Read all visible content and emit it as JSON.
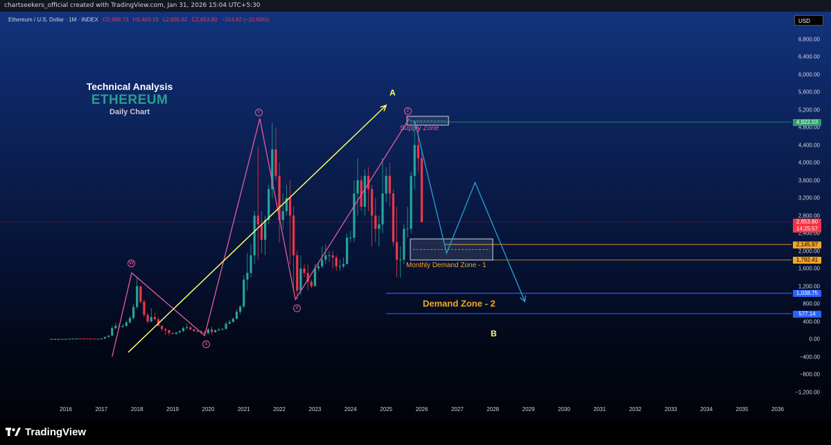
{
  "header": {
    "creator_line": "chartseekers_official created with TradingView.com, Jan 31, 2026 15:04 UTC+5:30"
  },
  "legend": {
    "symbol": "Ethereum / U.S. Dollar · 1M · INDEX",
    "open": "O2,968.73",
    "high": "H3,403.19",
    "low": "L2,605.62",
    "close": "C2,653.80",
    "change": "−314.82 (−10.60%)"
  },
  "currency_button": "USD",
  "titles": {
    "line1": "Technical Analysis",
    "line2": "ETHEREUM",
    "line3": "Daily Chart"
  },
  "annotations": {
    "wave_w": "W",
    "wave_x1": "X",
    "wave_y": "Y",
    "wave_x2": "X",
    "wave_z": "Z",
    "point_a": "A",
    "point_b": "B",
    "supply_zone": "Supply Zone",
    "monthly_demand": "Monthly Demand Zone - 1",
    "demand_zone_2": "Demand Zone - 2"
  },
  "price_tags": {
    "resistance": "4,922.03",
    "current_price": "2,653.80",
    "countdown": "14:25:57",
    "demand_top": "2,145.97",
    "demand_bottom": "1,792.41",
    "demand2_top": "1,038.75",
    "demand2_bottom": "577.14"
  },
  "footer": {
    "brand": "TradingView"
  },
  "colors": {
    "up_candle": "#26a69a",
    "down_candle": "#f23645",
    "wave_pink": "#e85b9e",
    "trend_yellow": "#ffff66",
    "projection_cyan": "#26a4d8",
    "demand_orange": "#f5a623",
    "zone2_blue": "#2962ff"
  },
  "chart_data": {
    "type": "candlestick",
    "title": "",
    "xlabel": "",
    "ylabel": "",
    "x_ticks": [
      "2016",
      "2017",
      "2018",
      "2019",
      "2020",
      "2021",
      "2022",
      "2023",
      "2024",
      "2025",
      "2026",
      "2027",
      "2028",
      "2029",
      "2030",
      "2031",
      "2032",
      "2033",
      "2034",
      "2035",
      "2036"
    ],
    "y_ticks": [
      "6,800.00",
      "6,400.00",
      "6,000.00",
      "5,600.00",
      "5,200.00",
      "4,800.00",
      "4,400.00",
      "4,000.00",
      "3,600.00",
      "3,200.00",
      "2,800.00",
      "2,400.00",
      "2,000.00",
      "1,600.00",
      "1,200.00",
      "800.00",
      "400.00",
      "0.00",
      "−400.00",
      "−800.00",
      "−1,200.00"
    ],
    "ylim": [
      -1200,
      6800
    ],
    "series": [
      {
        "name": "Ethereum / U.S. Dollar",
        "time": [
          2015.6,
          2015.7,
          2015.8,
          2015.9,
          2016.0,
          2016.1,
          2016.2,
          2016.3,
          2016.4,
          2016.5,
          2016.6,
          2016.7,
          2016.8,
          2016.9,
          2017.0,
          2017.1,
          2017.2,
          2017.3,
          2017.4,
          2017.5,
          2017.6,
          2017.7,
          2017.8,
          2017.9,
          2018.0,
          2018.1,
          2018.2,
          2018.3,
          2018.4,
          2018.5,
          2018.6,
          2018.7,
          2018.8,
          2018.9,
          2019.0,
          2019.1,
          2019.2,
          2019.3,
          2019.4,
          2019.5,
          2019.6,
          2019.7,
          2019.8,
          2019.9,
          2020.0,
          2020.1,
          2020.2,
          2020.3,
          2020.4,
          2020.5,
          2020.6,
          2020.7,
          2020.8,
          2020.9,
          2021.0,
          2021.1,
          2021.2,
          2021.3,
          2021.4,
          2021.5,
          2021.6,
          2021.7,
          2021.8,
          2021.9,
          2022.0,
          2022.1,
          2022.2,
          2022.3,
          2022.4,
          2022.5,
          2022.6,
          2022.7,
          2022.8,
          2022.9,
          2023.0,
          2023.1,
          2023.2,
          2023.3,
          2023.4,
          2023.5,
          2023.6,
          2023.7,
          2023.8,
          2023.9,
          2024.0,
          2024.1,
          2024.2,
          2024.3,
          2024.4,
          2024.5,
          2024.6,
          2024.7,
          2024.8,
          2024.9,
          2025.0,
          2025.1,
          2025.2,
          2025.3,
          2025.4,
          2025.5,
          2025.6,
          2025.7,
          2025.8,
          2025.9,
          2026.0
        ],
        "open": [
          1,
          1,
          1,
          1,
          1,
          5,
          10,
          12,
          14,
          13,
          12,
          11,
          10,
          8,
          8,
          15,
          50,
          80,
          250,
          300,
          280,
          300,
          380,
          480,
          730,
          1200,
          850,
          550,
          400,
          500,
          450,
          300,
          230,
          200,
          140,
          120,
          150,
          180,
          250,
          270,
          220,
          180,
          180,
          150,
          130,
          220,
          160,
          200,
          220,
          230,
          350,
          390,
          460,
          620,
          740,
          1350,
          1500,
          1900,
          2800,
          2600,
          2250,
          2700,
          3400,
          4300,
          3700,
          2700,
          2900,
          3200,
          2800,
          1900,
          1100,
          1600,
          1500,
          1300,
          1200,
          1600,
          1650,
          1800,
          1900,
          1900,
          1850,
          1650,
          1650,
          1700,
          2300,
          2300,
          3300,
          3600,
          3000,
          3700,
          3400,
          2800,
          2500,
          2600,
          3300,
          3700,
          3300,
          2200,
          1800,
          1800,
          2500,
          2500,
          3700,
          4400,
          4100
        ],
        "close": [
          1,
          1,
          1,
          1,
          5,
          10,
          12,
          14,
          13,
          12,
          11,
          10,
          8,
          8,
          15,
          50,
          80,
          250,
          300,
          280,
          300,
          380,
          480,
          730,
          1200,
          850,
          550,
          400,
          500,
          450,
          300,
          230,
          200,
          140,
          120,
          150,
          180,
          250,
          270,
          220,
          180,
          180,
          150,
          130,
          220,
          160,
          200,
          220,
          230,
          350,
          390,
          460,
          620,
          740,
          1350,
          1500,
          1900,
          2800,
          2600,
          2250,
          2700,
          3400,
          4300,
          3700,
          2700,
          2900,
          3200,
          2800,
          1900,
          1100,
          1600,
          1500,
          1300,
          1200,
          1600,
          1650,
          1800,
          1900,
          1900,
          1850,
          1650,
          1650,
          1700,
          2300,
          2300,
          3300,
          3600,
          3000,
          3700,
          3400,
          2800,
          2500,
          2600,
          3300,
          3700,
          3300,
          2200,
          1800,
          1800,
          2500,
          2500,
          3700,
          4400,
          4100,
          2650
        ],
        "high": [
          2,
          2,
          2,
          2,
          6,
          12,
          15,
          16,
          15,
          14,
          13,
          12,
          11,
          10,
          17,
          55,
          90,
          300,
          380,
          350,
          340,
          420,
          520,
          800,
          1420,
          1000,
          900,
          600,
          700,
          600,
          500,
          320,
          250,
          220,
          150,
          160,
          200,
          280,
          350,
          280,
          230,
          200,
          200,
          190,
          250,
          280,
          220,
          250,
          260,
          400,
          440,
          490,
          680,
          760,
          1450,
          1950,
          2150,
          2900,
          4350,
          2900,
          2800,
          3500,
          4900,
          4800,
          4000,
          3300,
          3500,
          3600,
          3000,
          2000,
          1900,
          1700,
          1700,
          1350,
          1700,
          1750,
          2100,
          2150,
          2000,
          2000,
          1900,
          1800,
          1850,
          2400,
          2450,
          3600,
          4100,
          3700,
          3850,
          3900,
          3500,
          3200,
          2800,
          4100,
          3900,
          4000,
          3400,
          3000,
          2100,
          2600,
          3000,
          3800,
          4950,
          4800,
          4300,
          3400
        ],
        "low": [
          0,
          0,
          0,
          0,
          0,
          4,
          8,
          10,
          11,
          10,
          9,
          9,
          6,
          6,
          7,
          12,
          45,
          70,
          220,
          240,
          250,
          280,
          350,
          440,
          680,
          800,
          500,
          350,
          380,
          420,
          290,
          180,
          100,
          80,
          110,
          100,
          140,
          170,
          220,
          200,
          170,
          160,
          120,
          120,
          120,
          100,
          140,
          180,
          200,
          220,
          340,
          370,
          450,
          560,
          700,
          1100,
          1400,
          1700,
          1800,
          1950,
          1900,
          2600,
          3200,
          3600,
          2200,
          2500,
          2800,
          1700,
          1100,
          900,
          1000,
          1400,
          1100,
          1150,
          1200,
          1550,
          1600,
          1700,
          1750,
          1600,
          1550,
          1550,
          1600,
          2100,
          2200,
          2200,
          2800,
          2900,
          2800,
          2900,
          2100,
          2200,
          2100,
          2400,
          3100,
          3000,
          2100,
          1400,
          1400,
          1700,
          2300,
          2400,
          3400,
          3800,
          4000,
          2600
        ]
      }
    ],
    "wxy_wave": [
      {
        "date": 2017.3,
        "price": -400
      },
      {
        "date": 2017.85,
        "price": 1500,
        "label": "W"
      },
      {
        "date": 2019.9,
        "price": 80,
        "label": "X"
      },
      {
        "date": 2021.45,
        "price": 5000,
        "label": "Y"
      },
      {
        "date": 2022.45,
        "price": 900,
        "label": "X"
      },
      {
        "date": 2025.65,
        "price": 5000,
        "label": "Z"
      }
    ],
    "trendline_a": [
      {
        "date": 2017.75,
        "price": -300
      },
      {
        "date": 2025.0,
        "price": 5300,
        "label": "A"
      }
    ],
    "projection_path": [
      {
        "date": 2025.8,
        "price": 4950
      },
      {
        "date": 2026.7,
        "price": 1950
      },
      {
        "date": 2027.5,
        "price": 3550
      },
      {
        "date": 2028.9,
        "price": 850
      }
    ],
    "zones": [
      {
        "name": "Supply Zone",
        "from": 2025.35,
        "to": 2026.5,
        "top": 5050,
        "bottom": 4850
      },
      {
        "name": "Monthly Demand Zone - 1",
        "from": 2026.65,
        "to": 2028.0,
        "top": 2145.97,
        "bottom": 1792.41
      },
      {
        "name": "Demand Zone - 2",
        "from": 2025.0,
        "to": 2036.6,
        "top": 1038.75,
        "bottom": 577.14
      }
    ],
    "horizontal_levels": [
      4922.03,
      2653.8,
      2145.97,
      1792.41,
      1038.75,
      577.14
    ],
    "point_b": {
      "date": 2028.0,
      "price": 100,
      "label": "B"
    }
  }
}
